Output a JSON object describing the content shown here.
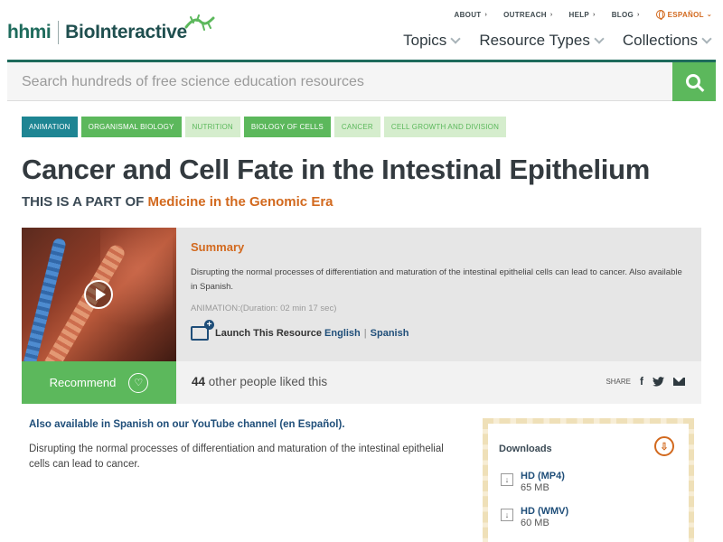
{
  "brand": {
    "org": "hhmi",
    "site": "BioInteractive"
  },
  "util_nav": [
    {
      "label": "ABOUT"
    },
    {
      "label": "OUTREACH"
    },
    {
      "label": "HELP"
    },
    {
      "label": "BLOG"
    }
  ],
  "language_toggle": "ESPAÑOL",
  "main_nav": [
    {
      "label": "Topics"
    },
    {
      "label": "Resource Types"
    },
    {
      "label": "Collections"
    }
  ],
  "search": {
    "placeholder": "Search hundreds of free science education resources"
  },
  "tags": [
    {
      "label": "ANIMATION",
      "style": "teal"
    },
    {
      "label": "ORGANISMAL BIOLOGY",
      "style": "green"
    },
    {
      "label": "NUTRITION",
      "style": "light"
    },
    {
      "label": "BIOLOGY OF CELLS",
      "style": "green"
    },
    {
      "label": "CANCER",
      "style": "light"
    },
    {
      "label": "CELL GROWTH AND DIVISION",
      "style": "light"
    }
  ],
  "page": {
    "title": "Cancer and Cell Fate in the Intestinal Epithelium",
    "part_of_prefix": "THIS IS A PART OF",
    "part_of_link": "Medicine in the Genomic Era"
  },
  "card": {
    "summary_heading": "Summary",
    "summary_text": "Disrupting the normal processes of differentiation and maturation of the intestinal epithelial cells can lead to cancer. Also available in Spanish.",
    "duration": "ANIMATION:(Duration: 02 min 17 sec)",
    "launch_label": "Launch This Resource",
    "lang_english": "English",
    "lang_separator": "|",
    "lang_spanish": "Spanish"
  },
  "recommend": {
    "button_label": "Recommend",
    "likes_count": "44",
    "likes_text": "other people liked this",
    "share_label": "SHARE"
  },
  "content": {
    "also_available": "Also available in Spanish on our YouTube channel (en Español).",
    "description": "Disrupting the normal processes of differentiation and maturation of the intestinal epithelial cells can lead to cancer."
  },
  "downloads": {
    "heading": "Downloads",
    "items": [
      {
        "name": "HD (MP4)",
        "size": "65 MB"
      },
      {
        "name": "HD (WMV)",
        "size": "60 MB"
      }
    ]
  },
  "colors": {
    "brand_green": "#5cb85c",
    "brand_dark": "#1e6b5c",
    "accent_orange": "#d2691e",
    "link_blue": "#1f4e79",
    "tag_teal": "#1e8593"
  }
}
